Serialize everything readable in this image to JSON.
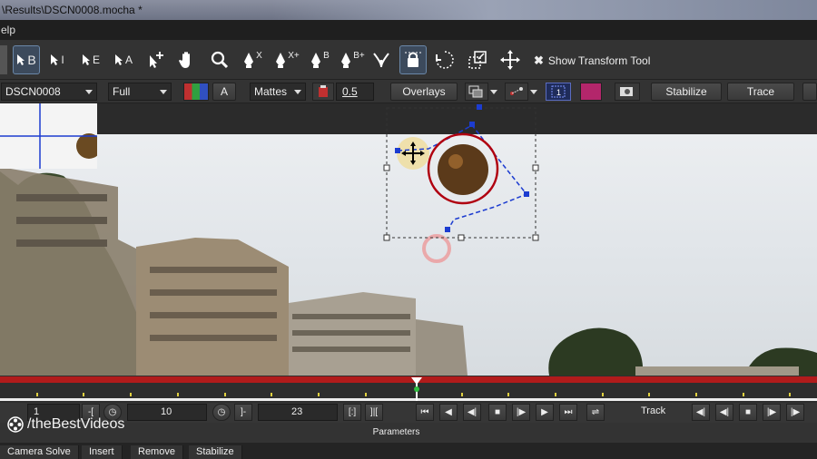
{
  "window": {
    "title": "\\Results\\DSCN0008.mocha *"
  },
  "menu": {
    "partial_label": "elp"
  },
  "toolbar": {
    "tools": [
      {
        "name": "select-b",
        "label": "B"
      },
      {
        "name": "select-i",
        "label": "I"
      },
      {
        "name": "select-e",
        "label": "E"
      },
      {
        "name": "select-a",
        "label": "A"
      },
      {
        "name": "add-point",
        "label": "+"
      },
      {
        "name": "pan",
        "label": ""
      },
      {
        "name": "zoom",
        "label": ""
      },
      {
        "name": "pen-x",
        "label": "X"
      },
      {
        "name": "pen-xplus",
        "label": "X+"
      },
      {
        "name": "pen-b",
        "label": "B"
      },
      {
        "name": "pen-bplus",
        "label": "B+"
      }
    ],
    "show_transform_label": "Show Transform Tool"
  },
  "toolbar2": {
    "clip": "DSCN0008",
    "view": "Full",
    "channel_label": "A",
    "mattes": "Mattes",
    "opacity": "0.5",
    "overlays": "Overlays",
    "stabilize": "Stabilize",
    "trace": "Trace",
    "colors": {
      "magenta": "#b3266b",
      "accent_blue": "#3552c8"
    }
  },
  "transport": {
    "frame_start": "1",
    "frame_in": "10",
    "frame_out": "23",
    "track_label": "Track"
  },
  "panel": {
    "title": "Parameters"
  },
  "watermark": {
    "text": "/theBestVideos"
  },
  "tabs": [
    "Camera Solve",
    "Insert",
    "Remove",
    "Stabilize"
  ]
}
